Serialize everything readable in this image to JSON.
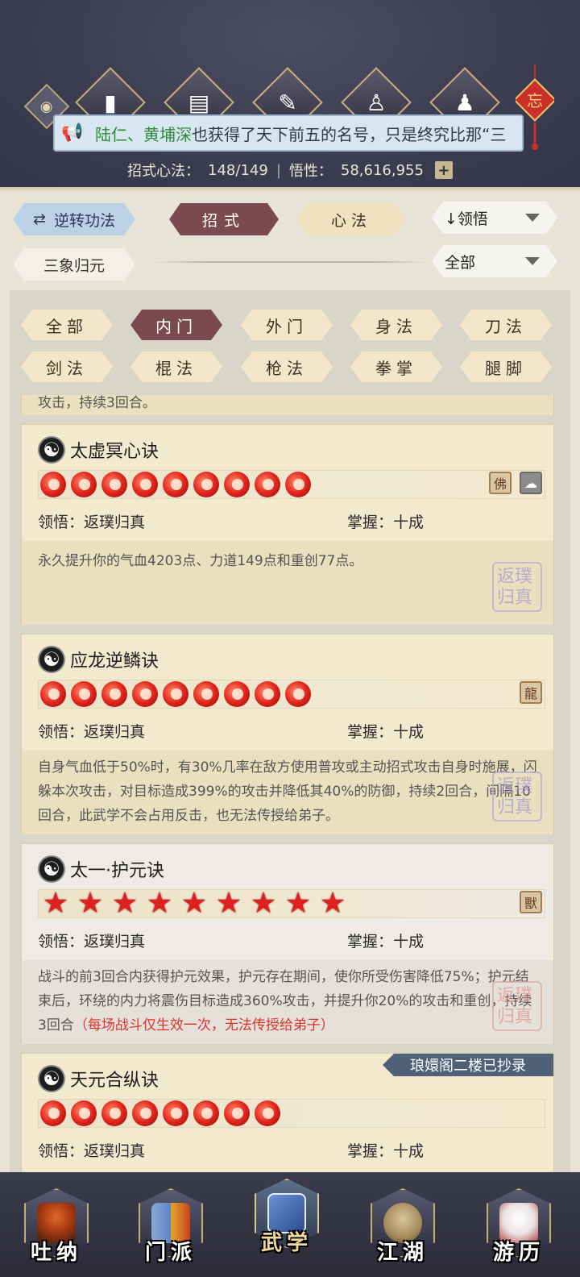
{
  "header": {
    "top_icons": [
      "pillar-icon",
      "scroll-icon",
      "brush-scroll-icon",
      "meditate-figure-icon",
      "martial-stance-icon"
    ],
    "knot_char": "忘",
    "ticker": {
      "names": "陆仁、黄埔深",
      "text": "也获得了天下前五的名号，只是终究比那“三"
    },
    "stats": {
      "skills_label": "招式心法：",
      "skills_value": "148/149",
      "wisdom_label": "悟性：",
      "wisdom_value": "58,616,955"
    }
  },
  "controls": {
    "reverse_btn": "逆转功法",
    "tab_moves": "招式",
    "tab_mind": "心法",
    "sort_dropdown": "↓领悟",
    "three_elements_btn": "三象归元",
    "filter_dropdown": "全部"
  },
  "filters": {
    "row1": [
      "全部",
      "内门",
      "外门",
      "身法",
      "刀法"
    ],
    "row2": [
      "剑法",
      "棍法",
      "枪法",
      "拳掌",
      "腿脚"
    ],
    "active": "内门"
  },
  "cards": [
    {
      "title": "太虚冥心诀",
      "rank_type": "orb",
      "rank_count": 9,
      "badges": [
        "buddha-badge-icon",
        "cloud-badge-icon"
      ],
      "comprehension_label": "领悟：",
      "comprehension_value": "返璞归真",
      "mastery_label": "掌握：",
      "mastery_value": "十成",
      "desc": "永久提升你的气血4203点、力道149点和重创77点。",
      "seal": "返璞归真"
    },
    {
      "title": "应龙逆鳞诀",
      "rank_type": "orb",
      "rank_count": 9,
      "badges": [
        "dragon-badge-icon"
      ],
      "comprehension_label": "领悟：",
      "comprehension_value": "返璞归真",
      "mastery_label": "掌握：",
      "mastery_value": "十成",
      "desc": "自身气血低于50%时，有30%几率在敌方使用普攻或主动招式攻击自身时施展，闪躲本次攻击，对目标造成399%的攻击并降低其40%的防御，持续2回合，间隔10回合，此武学不会占用反击，也无法传授给弟子。",
      "seal": "返璞归真"
    },
    {
      "title": "太一·护元诀",
      "rank_type": "star",
      "rank_count": 9,
      "badges": [
        "beast-badge-icon"
      ],
      "comprehension_label": "领悟：",
      "comprehension_value": "返璞归真",
      "mastery_label": "掌握：",
      "mastery_value": "十成",
      "desc": "战斗的前3回合内获得护元效果，护元存在期间，使你所受伤害降低75%；护元结束后，环绕的内力将震伤目标造成360%攻击，并提升你20%的攻击和重创，持续3回合",
      "desc_red": "（每场战斗仅生效一次，无法传授给弟子）",
      "seal": "返璞归真"
    },
    {
      "title": "天元合纵诀",
      "rank_type": "orb",
      "rank_count": 8,
      "ribbon": "琅嬛阁二楼已抄录",
      "comprehension_label": "领悟：",
      "comprehension_value": "返璞归真",
      "mastery_label": "掌握：",
      "mastery_value": "十成"
    }
  ],
  "partial_top_text": "攻击，持续3回合。",
  "bottom_nav": [
    {
      "label": "吐纳",
      "icon": "monk-icon"
    },
    {
      "label": "门派",
      "icon": "sect-banner-icon"
    },
    {
      "label": "武学",
      "icon": "martial-book-icon",
      "active": true
    },
    {
      "label": "江湖",
      "icon": "bamboo-hat-icon"
    },
    {
      "label": "游历",
      "icon": "horse-icon"
    }
  ]
}
